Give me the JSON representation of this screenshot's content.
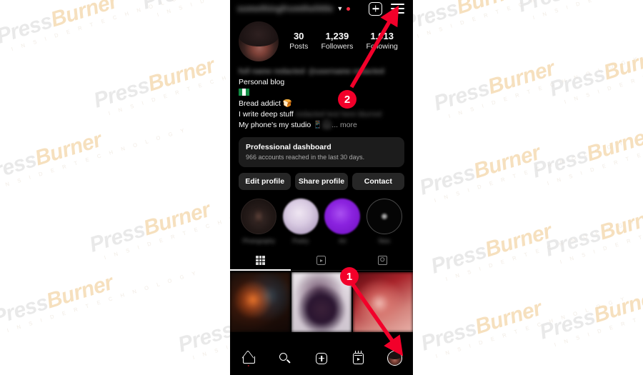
{
  "watermark": {
    "brand_press": "Press",
    "brand_burner": "Burner",
    "tagline": "I N S I D E R   T E C H N O L O G Y",
    "color_press": "#d8d8d8",
    "color_burner": "#f0c88a"
  },
  "phone": {
    "topbar": {
      "username": "somethingfromthelittle",
      "chevron_icon": "chevron-down-icon",
      "notification_dot": "red-dot",
      "create_icon": "plus-square-icon",
      "menu_icon": "hamburger-menu-icon"
    },
    "profile": {
      "avatar_alt": "profile-photo",
      "stats": [
        {
          "number": "30",
          "label": "Posts"
        },
        {
          "number": "1,239",
          "label": "Followers"
        },
        {
          "number": "1,013",
          "label": "Following"
        }
      ],
      "bio": {
        "name_blurred": "full name redacted",
        "handle_blurred": "@username redacted",
        "category": "Personal blog",
        "flag": "nigeria-flag",
        "line_bread": "Bread addict",
        "bread_emoji": "🍞",
        "line_write": "I write deep stuff",
        "write_blurred": "redacted text here blurred",
        "line_studio": "My phone's my studio",
        "studio_emoji_phone": "📱",
        "studio_emoji_extra": "🎧",
        "more": "... more"
      }
    },
    "dashboard": {
      "title": "Professional dashboard",
      "subtitle": "966 accounts reached in the last 30 days."
    },
    "actions": [
      {
        "label": "Edit profile"
      },
      {
        "label": "Share profile"
      },
      {
        "label": "Contact"
      }
    ],
    "highlights": [
      {
        "label": "Photography",
        "style": "hl-1"
      },
      {
        "label": "Poetry",
        "style": "hl-2"
      },
      {
        "label": "Art",
        "style": "hl-3"
      },
      {
        "label": "New",
        "style": "hl-4"
      }
    ],
    "tabs": [
      {
        "name": "grid",
        "icon": "grid-icon",
        "active": true
      },
      {
        "name": "reels",
        "icon": "reels-icon",
        "active": false
      },
      {
        "name": "tagged",
        "icon": "tagged-icon",
        "active": false
      }
    ],
    "grid_cells": [
      {
        "style": "cell-1",
        "alt": "post-thumbnail-1"
      },
      {
        "style": "cell-2",
        "alt": "post-thumbnail-2"
      },
      {
        "style": "cell-3",
        "alt": "post-thumbnail-3"
      }
    ],
    "bottom_nav": [
      {
        "name": "home",
        "icon": "home-icon"
      },
      {
        "name": "search",
        "icon": "search-icon"
      },
      {
        "name": "create",
        "icon": "plus-square-icon"
      },
      {
        "name": "reels",
        "icon": "reels-icon"
      },
      {
        "name": "profile",
        "icon": "profile-avatar-icon"
      }
    ]
  },
  "annotations": [
    {
      "id": "1",
      "label": "1",
      "target": "profile-avatar-bottom-nav",
      "color": "#f2002a"
    },
    {
      "id": "2",
      "label": "2",
      "target": "hamburger-menu-icon",
      "color": "#f2002a"
    }
  ]
}
